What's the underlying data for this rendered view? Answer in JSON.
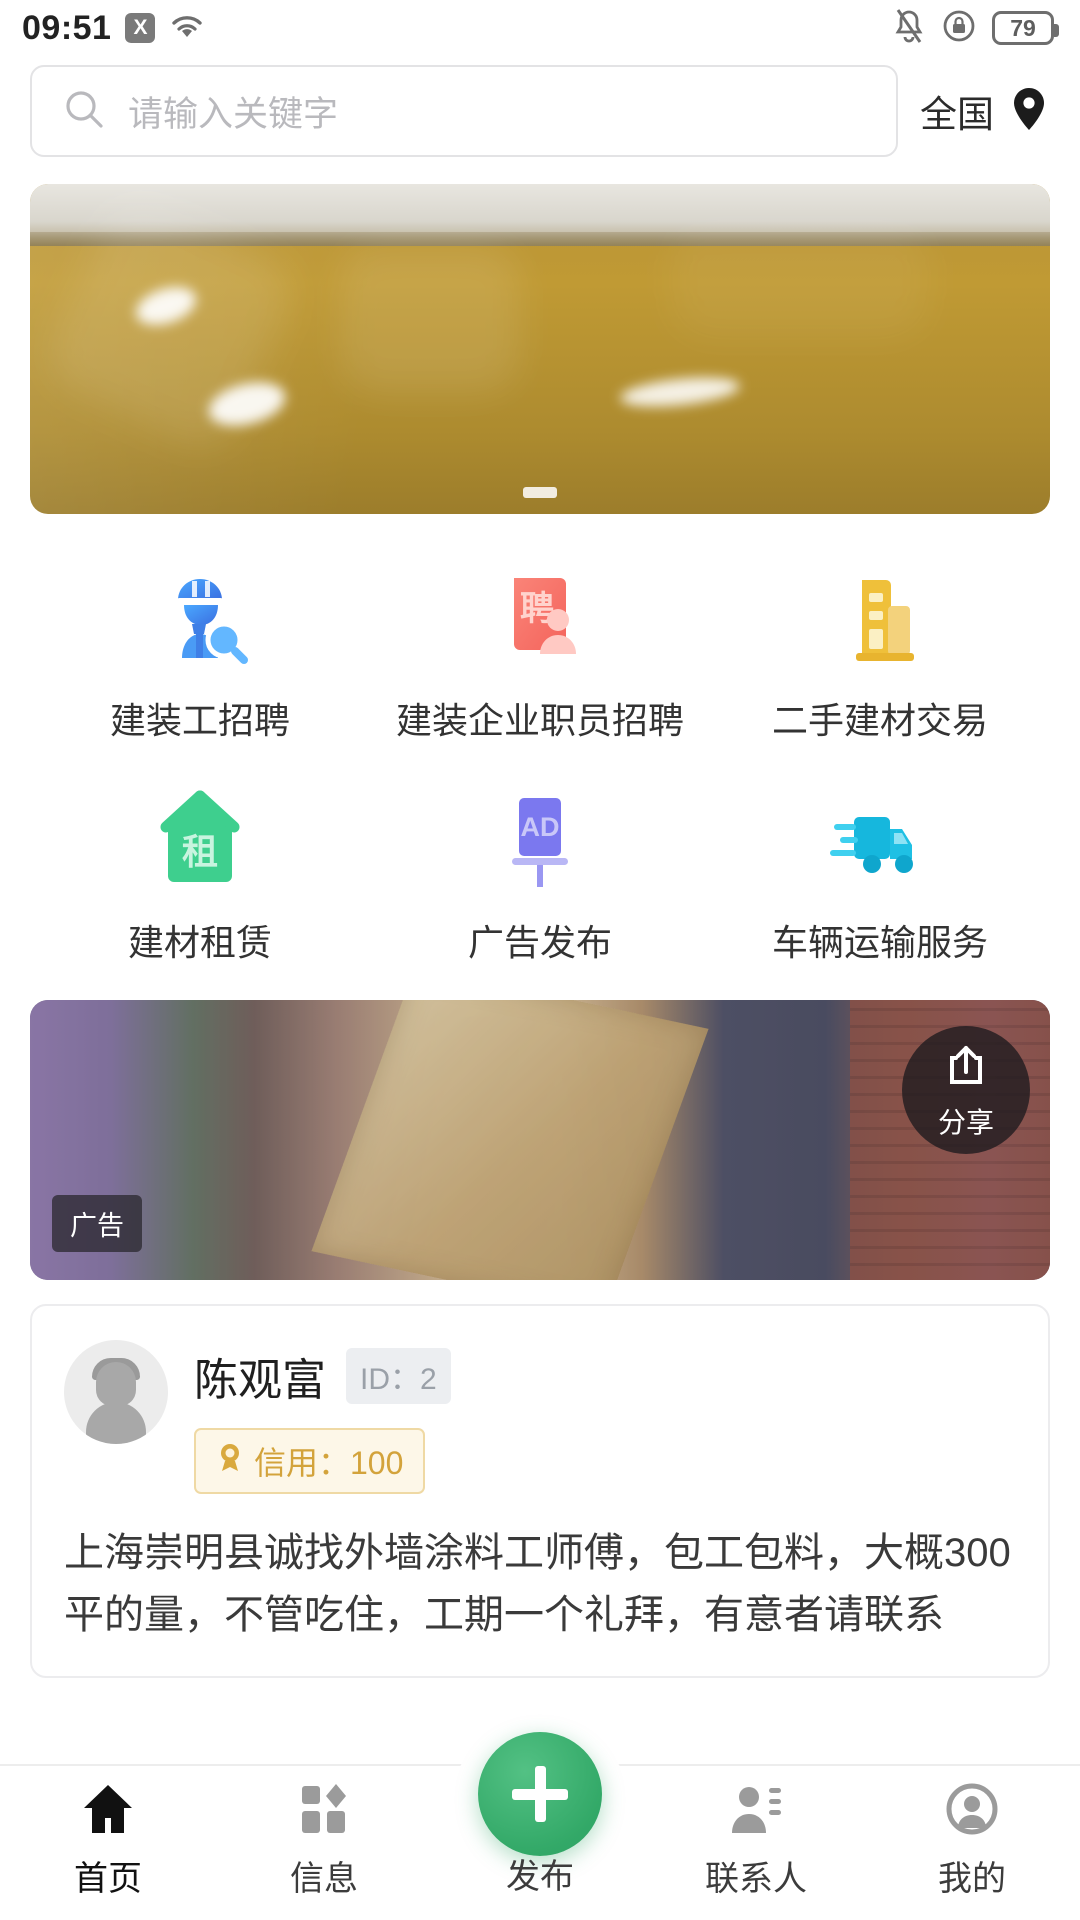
{
  "status_bar": {
    "time": "09:51",
    "no_sim_label": "X",
    "wifi_icon": "wifi-icon",
    "mute_icon": "bell-mute-icon",
    "rotation_lock_icon": "rotation-lock-icon",
    "battery_level": "79"
  },
  "header": {
    "search": {
      "placeholder": "请输入关键字",
      "value": "",
      "icon": "search-icon"
    },
    "region": {
      "label": "全国",
      "icon": "location-pin-icon"
    }
  },
  "banner": {
    "indicator_count": 1,
    "alt": "epoxy-floor-coating-photo"
  },
  "categories": [
    {
      "label": "建装工招聘",
      "icon": "worker-search-icon",
      "color": "#3d8ef7"
    },
    {
      "label": "建装企业职员招聘",
      "icon": "recruit-board-icon",
      "color": "#fa7268"
    },
    {
      "label": "二手建材交易",
      "icon": "building-icon",
      "color": "#f0c13b"
    },
    {
      "label": "建材租赁",
      "icon": "house-rent-icon",
      "color": "#3ecf8e"
    },
    {
      "label": "广告发布",
      "icon": "ad-billboard-icon",
      "color": "#7b78ef"
    },
    {
      "label": "车辆运输服务",
      "icon": "delivery-truck-icon",
      "color": "#23bcdf"
    }
  ],
  "ad": {
    "badge": "广告",
    "share": {
      "label": "分享",
      "icon": "share-icon"
    },
    "alt": "workers-carrying-wooden-door-photo"
  },
  "post": {
    "avatar_icon": "default-avatar-icon",
    "user_name": "陈观富",
    "id_badge": "ID：2",
    "credit_icon": "medal-icon",
    "credit_label": "信用：100",
    "content": "上海崇明县诚找外墙涂料工师傅，包工包料，大概300平的量，不管吃住，工期一个礼拜，有意者请联系"
  },
  "bottom_nav": {
    "items": [
      {
        "label": "首页",
        "icon": "home-icon",
        "active": true
      },
      {
        "label": "信息",
        "icon": "grid-messages-icon",
        "active": false
      },
      {
        "label": "发布",
        "icon": "plus-icon",
        "active": false
      },
      {
        "label": "联系人",
        "icon": "contacts-icon",
        "active": false
      },
      {
        "label": "我的",
        "icon": "profile-icon",
        "active": false
      }
    ],
    "fab_color": "#33a968"
  }
}
